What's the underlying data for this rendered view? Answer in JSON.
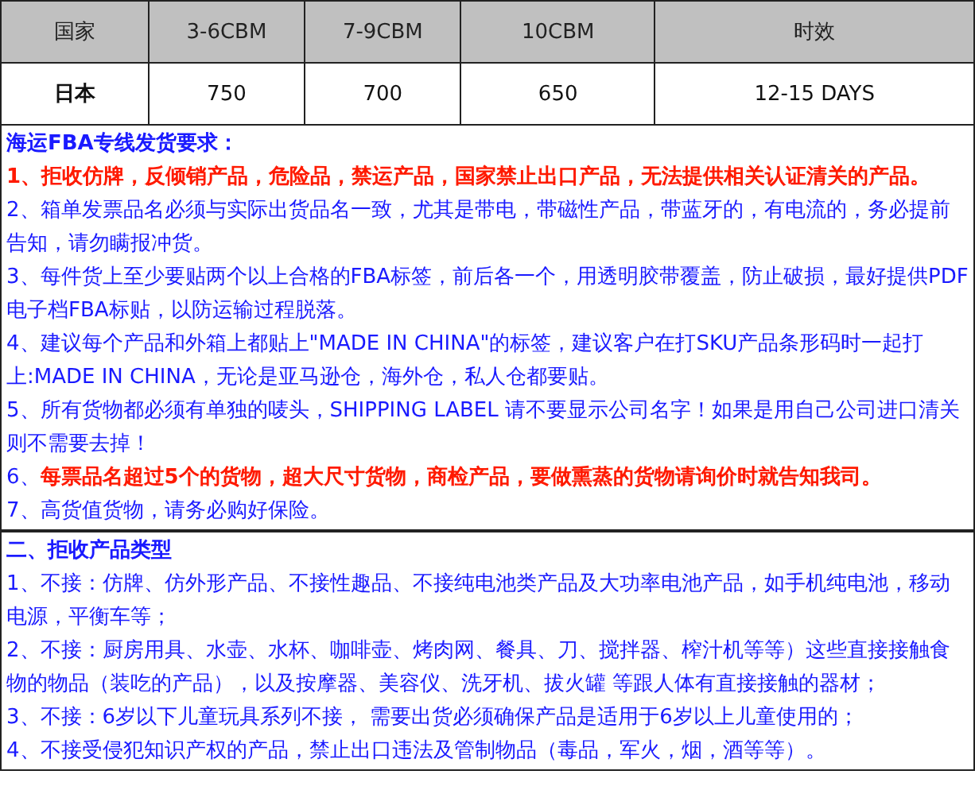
{
  "table": {
    "columns": [
      "国家",
      "3-6CBM",
      "7-9CBM",
      "10CBM",
      "时效"
    ],
    "rows": [
      [
        "日本",
        "750",
        "700",
        "650",
        "12-15 DAYS"
      ]
    ]
  },
  "sections": [
    {
      "title": "海运FBA专线发货要求：",
      "lines": [
        {
          "kind": "warning",
          "text": "1、拒收仿牌，反倾销产品，危险品，禁运产品，国家禁止出口产品，无法提供相关认证清关的产品。"
        },
        {
          "kind": "note",
          "text": "2、箱单发票品名必须与实际出货品名一致，尤其是带电，带磁性产品，带蓝牙的，有电流的，务必提前告知，请勿瞒报冲货。"
        },
        {
          "kind": "note",
          "text": "3、每件货上至少要贴两个以上合格的FBA标签，前后各一个，用透明胶带覆盖，防止破损，最好提供PDF电子档FBA标贴，以防运输过程脱落。"
        },
        {
          "kind": "note",
          "text": "4、建议每个产品和外箱上都贴上\"MADE IN CHINA\"的标签，建议客户在打SKU产品条形码时一起打上:MADE IN CHINA，无论是亚马逊仓，海外仓，私人仓都要贴。"
        },
        {
          "kind": "note",
          "text": "5、所有货物都必须有单独的唛头，SHIPPING LABEL 请不要显示公司名字！如果是用自己公司进口清关则不需要去掉！"
        },
        {
          "kind": "note",
          "text": "6、**每票品名超过5个的货物，超大尺寸货物，商检产品，要做熏蒸的货物请询价时就告知我司。**"
        },
        {
          "kind": "note",
          "text": "7、高货值货物，请务必购好保险。"
        }
      ]
    },
    {
      "title": "二、拒收产品类型",
      "lines": [
        {
          "kind": "note",
          "text": "1、不接：仿牌、仿外形产品、不接性趣品、不接纯电池类产品及大功率电池产品，如手机纯电池，移动电源，平衡车等；"
        },
        {
          "kind": "note",
          "text": "2、不接：厨房用具、水壶、水杯、咖啡壶、烤肉网、餐具、刀、搅拌器、榨汁机等等）这些直接接触食物的物品（装吃的产品），以及按摩器、美容仪、洗牙机、拔火罐 等跟人体有直接接触的器材；"
        },
        {
          "kind": "note",
          "text": "3、不接：6岁以下儿童玩具系列不接， 需要出货必须确保产品是适用于6岁以上儿童使用的；"
        },
        {
          "kind": "note",
          "text": "4、不接受侵犯知识产权的产品，禁止出口违法及管制物品（毒品，军火，烟，酒等等）。"
        }
      ]
    }
  ]
}
